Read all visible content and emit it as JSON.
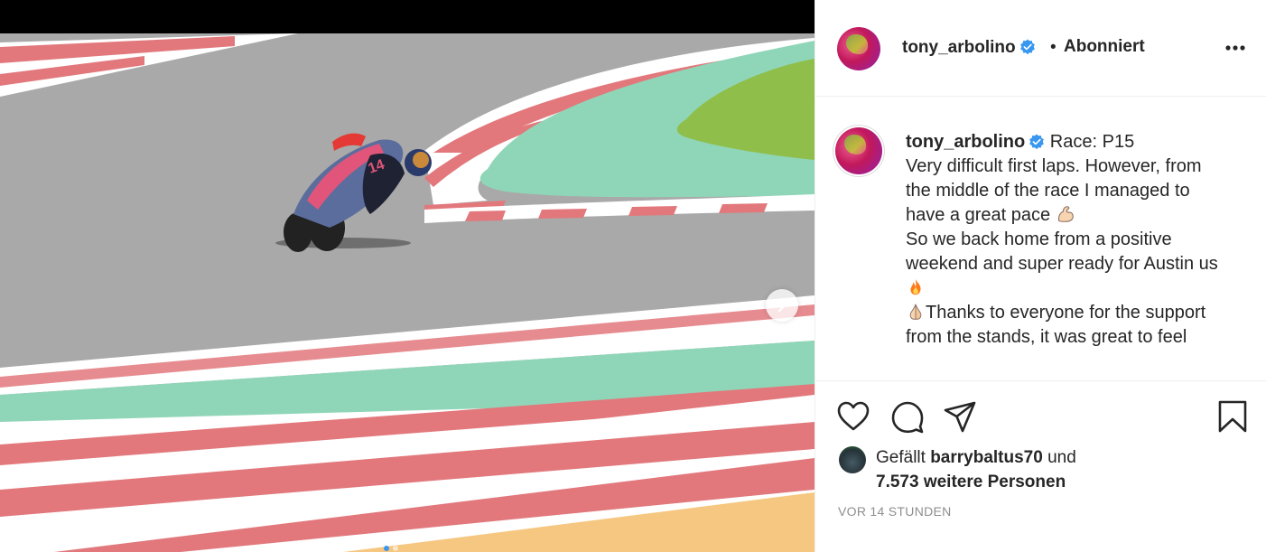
{
  "header": {
    "username": "tony_arbolino",
    "separator": "•",
    "follow_status": "Abonniert"
  },
  "caption": {
    "username": "tony_arbolino",
    "lines": [
      "Race: P15",
      "Very difficult first laps. However, from",
      "the middle of the race I managed to",
      "have a great pace",
      "So we back home from a positive",
      "weekend and super ready for Austin us",
      "",
      "",
      "Thanks to everyone for the support",
      "from the stands, it was great to feel"
    ]
  },
  "likes": {
    "prefix": "Gefällt",
    "liker": "barrybaltus70",
    "conjunction": "und",
    "others": "7.573 weitere Personen"
  },
  "timestamp": "VOR 14 STUNDEN",
  "icons": {
    "verified": "verified-badge-icon",
    "more": "more-options-icon",
    "next": "chevron-right-icon",
    "like": "heart-icon",
    "comment": "comment-bubble-icon",
    "share": "paper-plane-icon",
    "save": "bookmark-icon",
    "emoji_muscle": "flexed-biceps-emoji",
    "emoji_fire": "fire-emoji",
    "emoji_pray": "folded-hands-emoji"
  },
  "colors": {
    "verified_blue": "#3897f0",
    "text": "#262626",
    "muted": "#8e8e8e",
    "divider": "#efefef"
  },
  "carousel": {
    "slide_count": 2,
    "active_index": 0
  }
}
